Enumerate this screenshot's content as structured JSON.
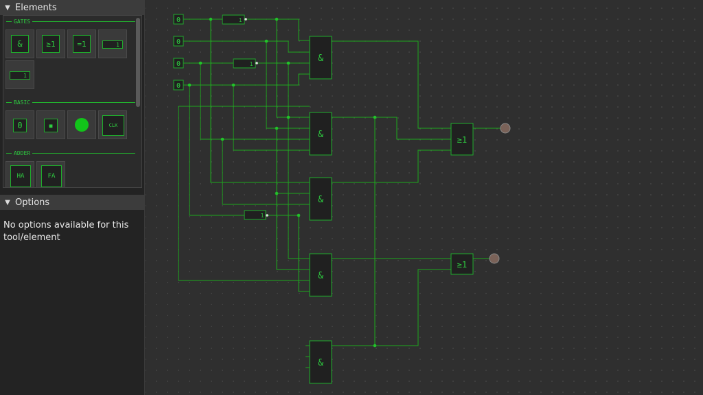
{
  "sidebar": {
    "elements_header": "Elements",
    "options_header": "Options",
    "options_text": "No options available for this tool/element",
    "sections": {
      "gates": "GATES",
      "basic": "BASIC",
      "adder": "ADDER"
    },
    "gate_tiles": [
      "&",
      "≥1",
      "=1",
      "1",
      "1"
    ],
    "basic_tiles": [
      "0",
      "■",
      "",
      "CLK"
    ],
    "adder_tiles": [
      "HA",
      "FA"
    ]
  },
  "circuit": {
    "inputs": [
      "0",
      "0",
      "0",
      "0"
    ],
    "and_label": "&",
    "or_label": "≥1",
    "not_label": "1"
  },
  "colors": {
    "wire": "#1ea81e",
    "gate_border": "#1fae2c",
    "gate_text": "#2ecc40",
    "output_led": "#7a6258"
  }
}
